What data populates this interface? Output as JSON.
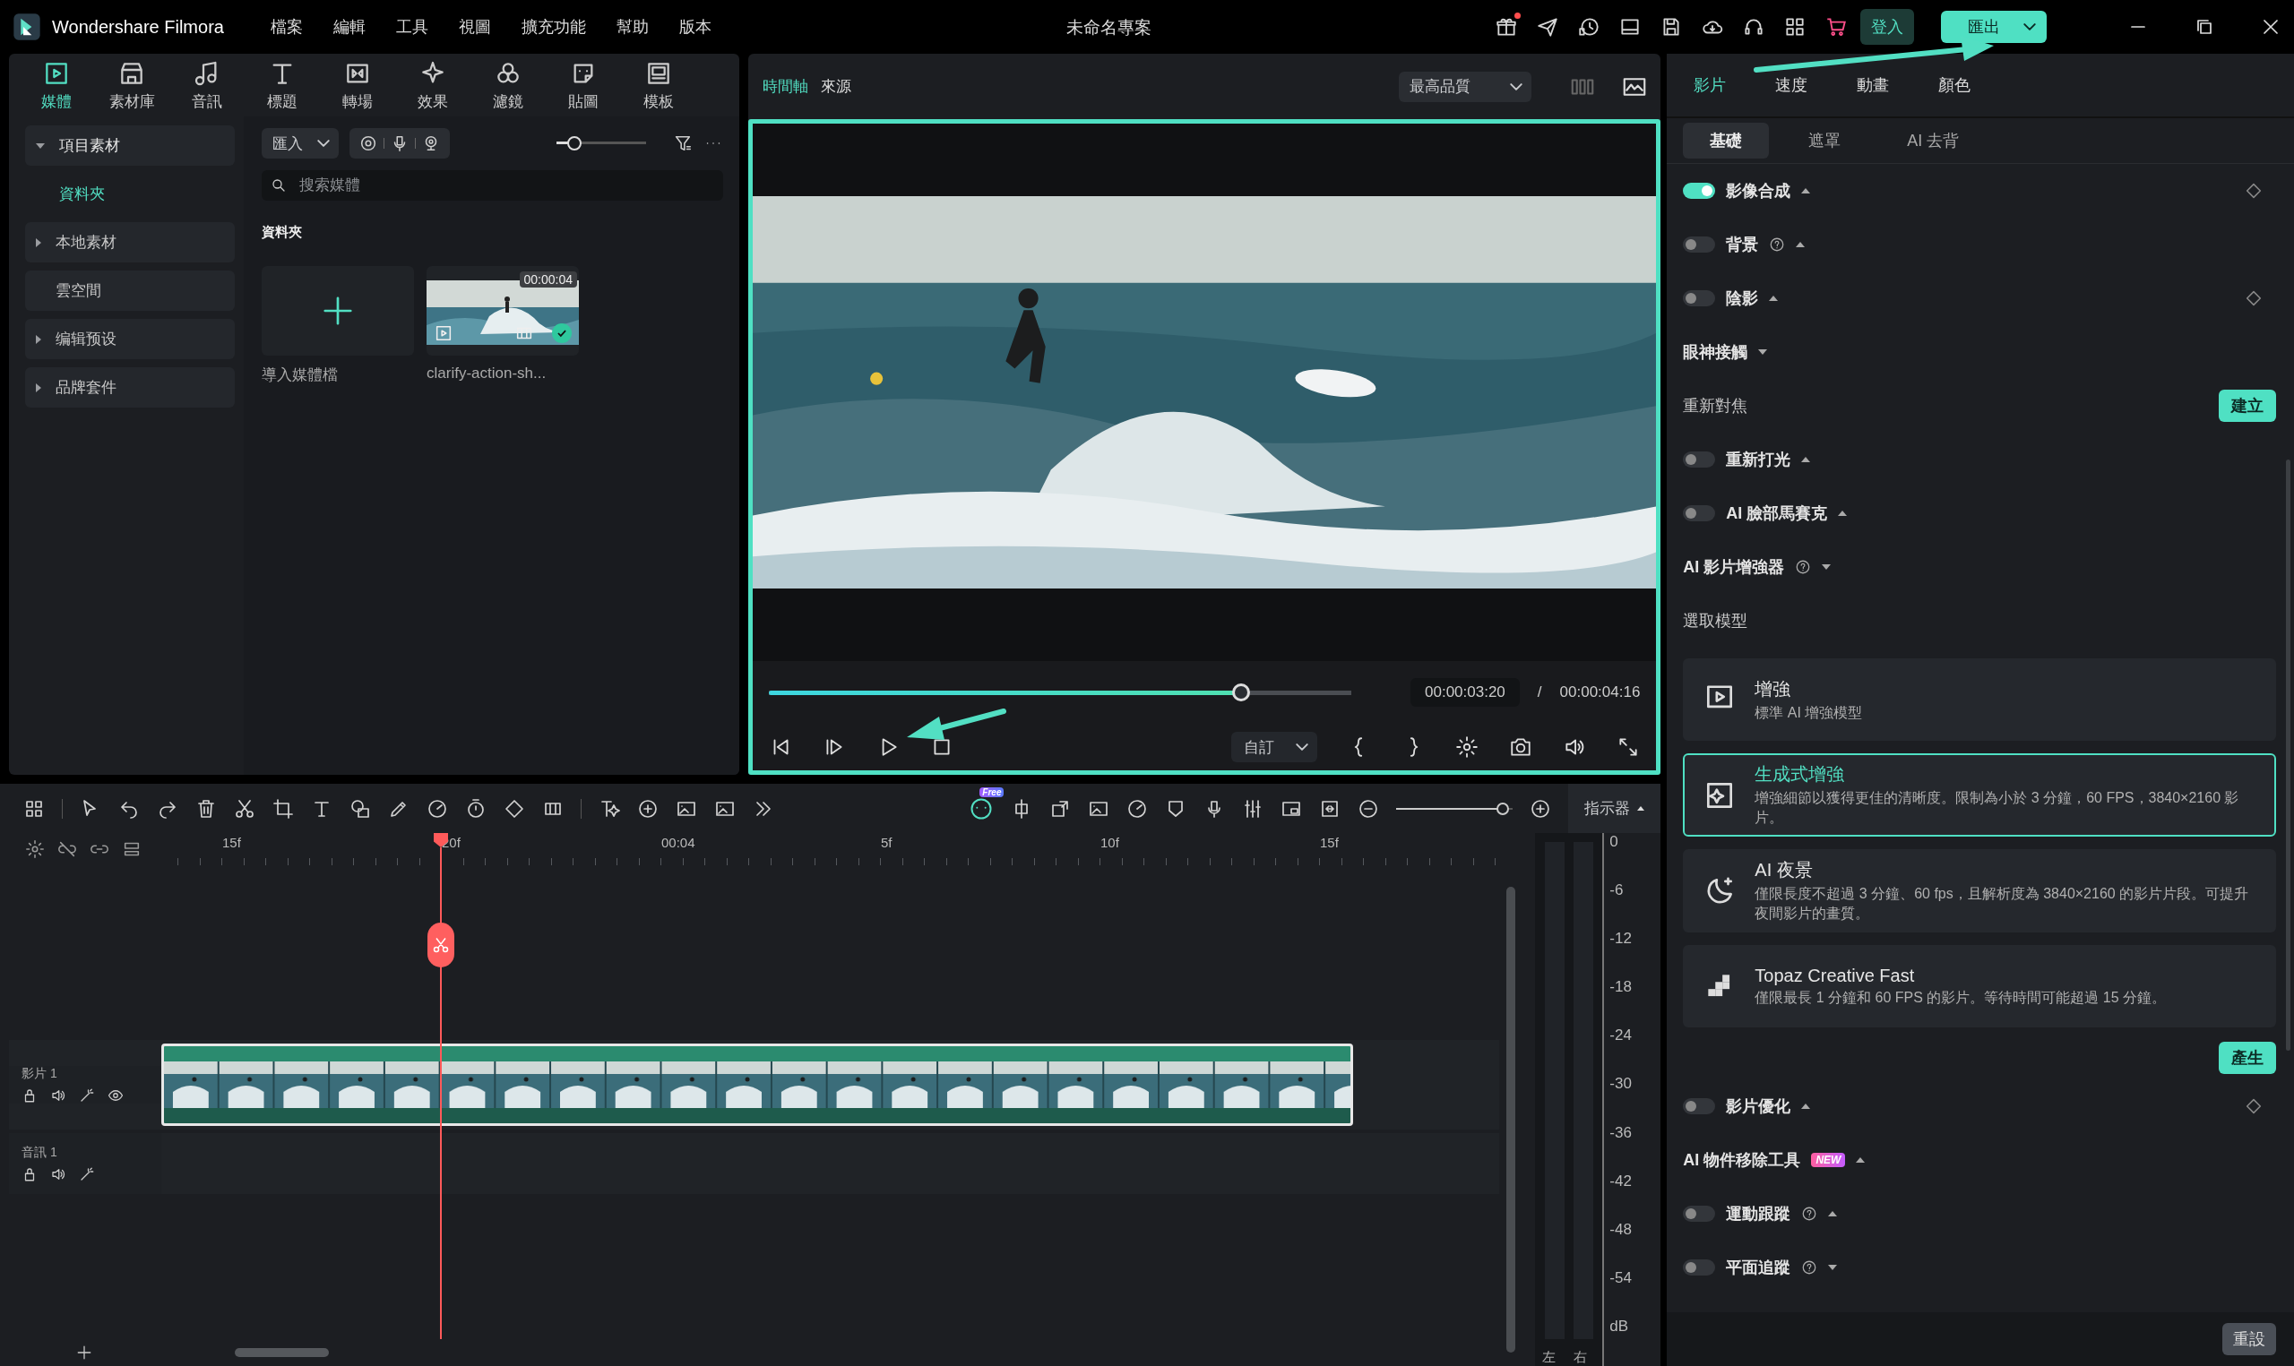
{
  "app": {
    "name": "Wondershare Filmora",
    "project_title": "未命名專案",
    "sign_in": "登入",
    "export": "匯出"
  },
  "menu": [
    "檔案",
    "編輯",
    "工具",
    "視圖",
    "擴充功能",
    "幫助",
    "版本"
  ],
  "media_tabs": [
    {
      "label": "媒體",
      "selected": true
    },
    {
      "label": "素材庫",
      "selected": false
    },
    {
      "label": "音訊",
      "selected": false
    },
    {
      "label": "標題",
      "selected": false
    },
    {
      "label": "轉場",
      "selected": false
    },
    {
      "label": "效果",
      "selected": false
    },
    {
      "label": "濾鏡",
      "selected": false
    },
    {
      "label": "貼圖",
      "selected": false
    },
    {
      "label": "模板",
      "selected": false
    }
  ],
  "sidebar": [
    {
      "label": "項目素材",
      "kind": "group",
      "expanded": true,
      "children": [
        {
          "label": "資料夾",
          "selected": true
        }
      ]
    },
    {
      "label": "本地素材",
      "kind": "group",
      "expanded": false
    },
    {
      "label": "雲空間",
      "kind": "plain"
    },
    {
      "label": "编辑预设",
      "kind": "group",
      "expanded": false
    },
    {
      "label": "品牌套件",
      "kind": "group",
      "expanded": false
    }
  ],
  "media": {
    "import": "匯入",
    "zoom": {
      "level": 0.2
    },
    "search_placeholder": "搜索媒體",
    "folder_title": "資料夾",
    "items": [
      {
        "kind": "import",
        "label": "導入媒體檔"
      },
      {
        "kind": "clip",
        "label": "clarify-action-sh...",
        "duration": "00:00:04",
        "checked": true
      }
    ]
  },
  "preview": {
    "tabs": [
      {
        "label": "時間軸",
        "selected": true
      },
      {
        "label": "來源",
        "selected": false
      }
    ],
    "quality": "最高品質",
    "progress": {
      "level": 0.81
    },
    "current_time": "00:00:03:20",
    "separator": "/",
    "total_time": "00:00:04:16",
    "zoom": "自訂"
  },
  "inspector": {
    "tabs": [
      {
        "label": "影片",
        "selected": true
      },
      {
        "label": "速度",
        "selected": false
      },
      {
        "label": "動畫",
        "selected": false
      },
      {
        "label": "顏色",
        "selected": false
      }
    ],
    "subtabs": [
      {
        "label": "基礎",
        "selected": true
      },
      {
        "label": "遮罩",
        "selected": false
      },
      {
        "label": "AI 去背",
        "selected": false
      }
    ],
    "rows_top": [
      {
        "kind": "toggle",
        "label": "影像合成",
        "on": true,
        "help": false,
        "expanded": false,
        "keyframe": true
      },
      {
        "kind": "toggle",
        "label": "背景",
        "on": false,
        "help": true,
        "expanded": false,
        "keyframe": false
      },
      {
        "kind": "toggle",
        "label": "陰影",
        "on": false,
        "help": false,
        "expanded": false,
        "keyframe": true
      },
      {
        "kind": "section",
        "label": "眼神接觸",
        "help": false,
        "expanded": true
      },
      {
        "kind": "action",
        "label": "重新對焦",
        "button": "建立"
      },
      {
        "kind": "toggle",
        "label": "重新打光",
        "on": false,
        "help": false,
        "expanded": false,
        "keyframe": false
      },
      {
        "kind": "toggle",
        "label": "AI 臉部馬賽克",
        "on": false,
        "help": false,
        "expanded": false,
        "keyframe": false
      },
      {
        "kind": "section",
        "label": "AI 影片增強器",
        "help": true,
        "expanded": true
      },
      {
        "kind": "label",
        "label": "選取模型"
      }
    ],
    "models": [
      {
        "kind": "hd",
        "title": "增強",
        "description": "標準 AI 增強模型",
        "selected": false
      },
      {
        "kind": "ai",
        "title": "生成式增強",
        "description": "增強細節以獲得更佳的清晰度。限制為小於 3 分鐘，60 FPS，3840×2160 影片。",
        "selected": true
      },
      {
        "kind": "night",
        "title": "AI 夜景",
        "description": "僅限長度不超過 3 分鐘、60 fps，且解析度為 3840×2160 的影片片段。可提升夜間影片的畫質。",
        "selected": false
      },
      {
        "kind": "pixel",
        "title": "Topaz Creative Fast",
        "description": "僅限最長 1 分鐘和 60 FPS 的影片。等待時間可能超過 15 分鐘。",
        "selected": false
      }
    ],
    "generate": "產生",
    "rows_bottom": [
      {
        "kind": "toggle",
        "label": "影片優化",
        "on": false,
        "help": false,
        "expanded": false,
        "keyframe": true
      },
      {
        "kind": "section",
        "label": "AI 物件移除工具",
        "help": false,
        "expanded": false,
        "badge": "NEW"
      },
      {
        "kind": "toggle",
        "label": "運動跟蹤",
        "on": false,
        "help": true,
        "expanded": false,
        "keyframe": false
      },
      {
        "kind": "toggle",
        "label": "平面追蹤",
        "on": false,
        "help": true,
        "expanded": true,
        "keyframe": false
      }
    ],
    "reset": "重設"
  },
  "timeline": {
    "free_badge": "Free",
    "zoom": {
      "level": 0.95
    },
    "indicator": "指示器",
    "ruler": [
      "15f",
      "20f",
      "00:04",
      "5f",
      "10f",
      "15f"
    ],
    "tracks": [
      {
        "kind": "video",
        "label": "影片 1"
      },
      {
        "kind": "audio",
        "label": "音訊 1"
      }
    ],
    "meter": {
      "scale": [
        "0",
        "-6",
        "-12",
        "-18",
        "-24",
        "-30",
        "-36",
        "-42",
        "-48",
        "-54",
        "dB"
      ],
      "channels": [
        "左",
        "右"
      ]
    }
  }
}
